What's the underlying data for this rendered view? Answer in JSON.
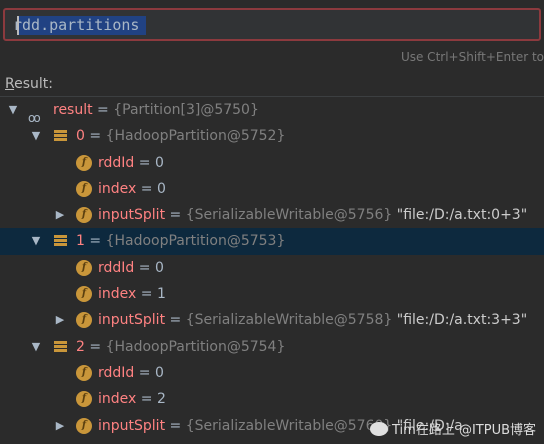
{
  "expression": {
    "value": "rdd.partitions"
  },
  "hint": "Use Ctrl+Shift+Enter to",
  "result_label": {
    "underlined": "R",
    "rest": "esult:"
  },
  "tree": {
    "root": {
      "name": "result",
      "eq": " = ",
      "ref": "{Partition[3]@5750}"
    },
    "items": [
      {
        "name": "0",
        "ref": "{HadoopPartition@5752}",
        "children": [
          {
            "name": "rddId",
            "value": "0"
          },
          {
            "name": "index",
            "value": "0"
          },
          {
            "name": "inputSplit",
            "ref": "{SerializableWritable@5756}",
            "value": "\"file:/D:/a.txt:0+3\""
          }
        ]
      },
      {
        "name": "1",
        "ref": "{HadoopPartition@5753}",
        "children": [
          {
            "name": "rddId",
            "value": "0"
          },
          {
            "name": "index",
            "value": "1"
          },
          {
            "name": "inputSplit",
            "ref": "{SerializableWritable@5758}",
            "value": "\"file:/D:/a.txt:3+3\""
          }
        ]
      },
      {
        "name": "2",
        "ref": "{HadoopPartition@5754}",
        "children": [
          {
            "name": "rddId",
            "value": "0"
          },
          {
            "name": "index",
            "value": "2"
          },
          {
            "name": "inputSplit",
            "ref": "{SerializableWritable@5760}",
            "value": "\"file:/D:/a"
          }
        ]
      }
    ]
  },
  "watermark": "Tim在路上 @ITPUB博客",
  "colors": {
    "selection": "#0d293e",
    "border": "#8c3a3e",
    "field_name": "#ff8282"
  }
}
